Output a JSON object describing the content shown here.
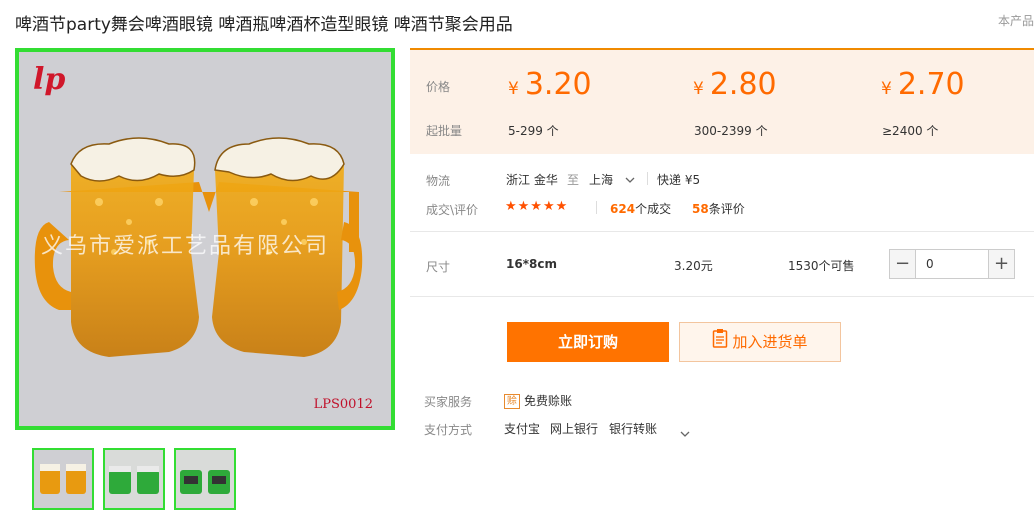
{
  "header": {
    "title": "啤酒节party舞会啤酒眼镜 啤酒瓶啤酒杯造型眼镜 啤酒节聚会用品",
    "tag": "本产品"
  },
  "gallery": {
    "logo": "lp",
    "watermark": "义乌市爱派工艺品有限公司",
    "code": "LPS0012",
    "thumbnail_count": 3,
    "border_color": "#33dd33"
  },
  "pricing": {
    "price_label": "价格",
    "moq_label": "起批量",
    "currency": "¥",
    "tiers": [
      {
        "price": "3.20",
        "range": "5-299 个"
      },
      {
        "price": "2.80",
        "range": "300-2399 个"
      },
      {
        "price": "2.70",
        "range": "≥2400 个"
      }
    ],
    "accent_color": "#ff6a00"
  },
  "logistics": {
    "label": "物流",
    "origin": "浙江 金华",
    "to": "至",
    "destination": "上海",
    "express": "快递 ¥5"
  },
  "deals": {
    "label": "成交\\评价",
    "stars": "★★★★★",
    "deal_count": "624",
    "deal_suffix": "个成交",
    "review_count": "58",
    "review_suffix": "条评价"
  },
  "sku": {
    "label": "尺寸",
    "size": "16*8cm",
    "price": "3.20元",
    "stock": "1530个可售",
    "quantity": "0"
  },
  "actions": {
    "buy": "立即订购",
    "add_list": "加入进货单"
  },
  "services": {
    "label": "买家服务",
    "item": "免费赊账",
    "icon_char": "赊"
  },
  "payment": {
    "label": "支付方式",
    "methods": [
      "支付宝",
      "网上银行",
      "银行转账"
    ]
  }
}
